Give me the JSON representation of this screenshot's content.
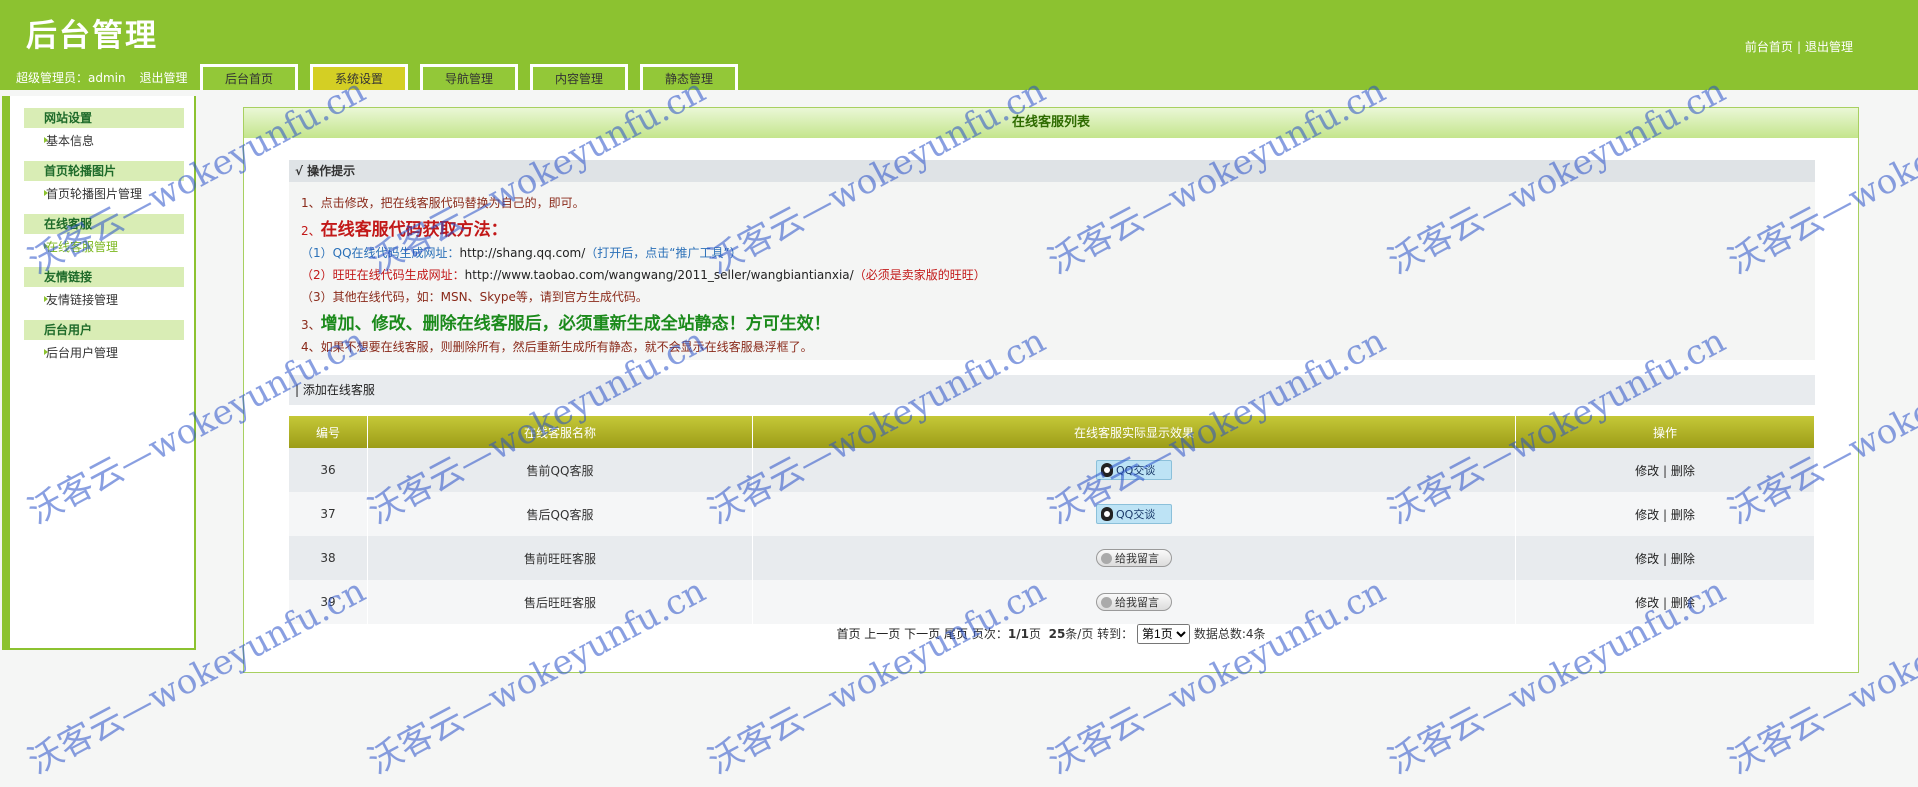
{
  "header": {
    "logo": "后台管理",
    "admin_label": "超级管理员：admin",
    "logout": "退出管理",
    "front_home": "前台首页",
    "separator": "|",
    "exit": "退出管理"
  },
  "tabs": [
    "后台首页",
    "系统设置",
    "导航管理",
    "内容管理",
    "静态管理"
  ],
  "sidebar": {
    "groups": [
      {
        "title": "网站设置",
        "item": "基本信息"
      },
      {
        "title": "首页轮播图片",
        "item": "首页轮播图片管理"
      },
      {
        "title": "在线客服",
        "item": "在线客服管理"
      },
      {
        "title": "友情链接",
        "item": "友情链接管理"
      },
      {
        "title": "后台用户",
        "item": "后台用户管理"
      }
    ]
  },
  "panel": {
    "title": "在线客服列表",
    "tips_title": "√ 操作提示",
    "tips": {
      "t1": "1、点击修改，把在线客服代码替换为自己的，即可。",
      "t2_num": "2、",
      "t2": "在线客服代码获取方法：",
      "t3_pre": "（1）QQ在线代码生成网址：",
      "t3_link": "http://shang.qq.com/",
      "t3_post": "（打开后，点击“推广工具”）",
      "t4_pre": "（2）旺旺在线代码生成网址：",
      "t4_link": "http://www.taobao.com/wangwang/2011_seller/wangbiantianxia/",
      "t4_post": "（必须是卖家版的旺旺）",
      "t5": "（3）其他在线代码，如：MSN、Skype等，请到官方生成代码。",
      "t6_num": "3、",
      "t6": "增加、修改、删除在线客服后，必须重新生成全站静态！方可生效！",
      "t7": "4、如果不想要在线客服，则删除所有，然后重新生成所有静态，就不会显示在线客服悬浮框了。"
    },
    "add_prefix": "|",
    "add_link": "添加在线客服"
  },
  "table": {
    "headers": [
      "编号",
      "在线客服名称",
      "在线客服实际显示效果",
      "操作"
    ],
    "rows": [
      {
        "id": "36",
        "name": "售前QQ客服",
        "type": "qq",
        "button": "QQ交谈"
      },
      {
        "id": "37",
        "name": "售后QQ客服",
        "type": "qq",
        "button": "QQ交谈"
      },
      {
        "id": "38",
        "name": "售前旺旺客服",
        "type": "ww",
        "button": "给我留言"
      },
      {
        "id": "39",
        "name": "售后旺旺客服",
        "type": "ww",
        "button": "给我留言"
      }
    ],
    "edit": "修改",
    "sep": "|",
    "delete": "删除"
  },
  "pager": {
    "first": "首页",
    "prev": "上一页",
    "next": "下一页",
    "last": "尾页",
    "page_label": "页次：",
    "page_value": "1/1",
    "page_unit": "页",
    "per_page": "25",
    "per_page_unit": "条/页",
    "goto": "转到：",
    "select_option": "第1页",
    "total": "数据总数:4条"
  },
  "watermark": "沃客云—wokeyunfu.cn"
}
